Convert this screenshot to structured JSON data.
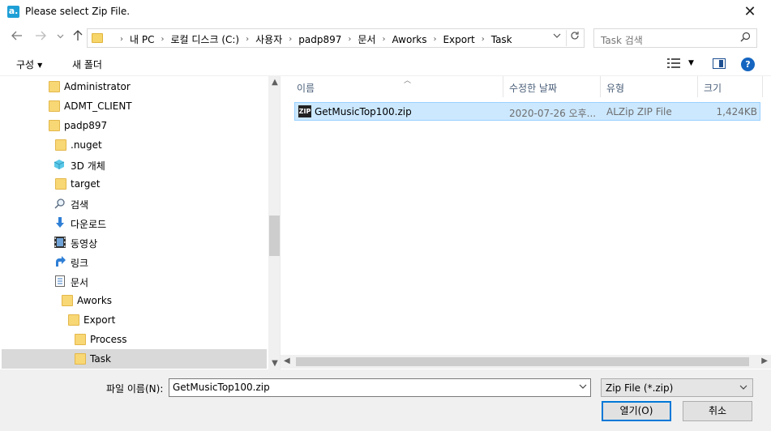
{
  "window": {
    "title": "Please select Zip File.",
    "app_icon_letter": "a.",
    "close_glyph": "✕"
  },
  "navigation": {
    "back_icon": "arrow-left-icon",
    "breadcrumbs": [
      "내 PC",
      "로컬 디스크 (C:)",
      "사용자",
      "padp897",
      "문서",
      "Aworks",
      "Export",
      "Task"
    ],
    "search_placeholder": "Task 검색"
  },
  "toolbar": {
    "organize_label": "구성",
    "new_folder_label": "새 폴더"
  },
  "tree": {
    "items": [
      {
        "label": "Administrator",
        "icon": "folder-icon",
        "indent": 0
      },
      {
        "label": "ADMT_CLIENT",
        "icon": "folder-icon",
        "indent": 0
      },
      {
        "label": "padp897",
        "icon": "folder-icon",
        "indent": 0
      },
      {
        "label": ".nuget",
        "icon": "folder-icon",
        "indent": 1
      },
      {
        "label": "3D 개체",
        "icon": "3d-objects-icon",
        "indent": 1
      },
      {
        "label": "target",
        "icon": "folder-icon",
        "indent": 1
      },
      {
        "label": "검색",
        "icon": "search-icon",
        "indent": 1
      },
      {
        "label": "다운로드",
        "icon": "download-icon",
        "indent": 1
      },
      {
        "label": "동영상",
        "icon": "video-icon",
        "indent": 1
      },
      {
        "label": "링크",
        "icon": "link-icon",
        "indent": 1
      },
      {
        "label": "문서",
        "icon": "document-icon",
        "indent": 1
      },
      {
        "label": "Aworks",
        "icon": "folder-icon",
        "indent": 2
      },
      {
        "label": "Export",
        "icon": "folder-icon",
        "indent": 3
      },
      {
        "label": "Process",
        "icon": "folder-icon",
        "indent": 4
      },
      {
        "label": "Task",
        "icon": "folder-icon",
        "indent": 4,
        "selected": true
      }
    ]
  },
  "list": {
    "columns": [
      "이름",
      "수정한 날짜",
      "유형",
      "크기"
    ],
    "rows": [
      {
        "name": "GetMusicTop100.zip",
        "modified": "2020-07-26 오후...",
        "type": "ALZip ZIP File",
        "size": "1,424KB",
        "icon": "zip-file-icon"
      }
    ]
  },
  "footer": {
    "filename_label": "파일 이름(N):",
    "filename_value": "GetMusicTop100.zip",
    "filter_value": "Zip File (*.zip)",
    "open_label": "열기(O)",
    "cancel_label": "취소"
  },
  "colors": {
    "selection": "#cce8ff",
    "accent": "#0078d7",
    "folder": "#f8d775"
  }
}
